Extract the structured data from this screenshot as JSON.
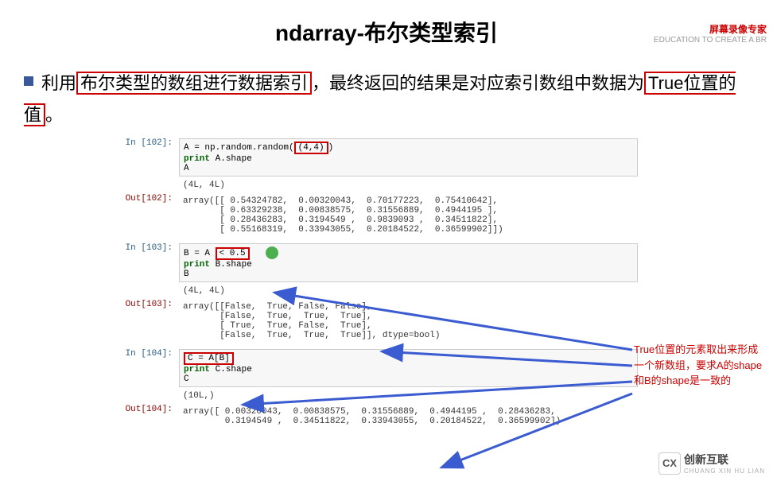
{
  "watermark": {
    "line1": "屏幕录像专家",
    "line2": "EDUCATION TO CREATE A BR"
  },
  "title": "ndarray-布尔类型索引",
  "desc": {
    "part1": "利用",
    "highlight1": "布尔类型的数组进行数据索引",
    "part2": "，最终返回的结果是对应索引数组中数据为",
    "highlight2": "True位置的值",
    "part3": "。"
  },
  "cells": [
    {
      "in_prompt": "In [102]:",
      "code": {
        "line1a": "A = np.random.random(",
        "line1b": "(4,4)",
        "line1c": ")",
        "line2a": "print",
        "line2b": " A.shape",
        "line3": "A"
      },
      "result": "(4L, 4L)",
      "out_prompt": "Out[102]:",
      "out": "array([[ 0.54324782,  0.00320043,  0.70177223,  0.75410642],\n       [ 0.63329238,  0.00838575,  0.31556889,  0.4944195 ],\n       [ 0.28436283,  0.3194549 ,  0.9839093 ,  0.34511822],\n       [ 0.55168319,  0.33943055,  0.20184522,  0.36599902]])"
    },
    {
      "in_prompt": "In [103]:",
      "code": {
        "line1a": "B = A ",
        "line1b": "< 0.5",
        "line2a": "print",
        "line2b": " B.shape",
        "line3": "B"
      },
      "result": "(4L, 4L)",
      "out_prompt": "Out[103]:",
      "out": "array([[False,  True, False, False],\n       [False,  True,  True,  True],\n       [ True,  True, False,  True],\n       [False,  True,  True,  True]], dtype=bool)"
    },
    {
      "in_prompt": "In [104]:",
      "code": {
        "line1": "C = A[B]",
        "line2a": "print",
        "line2b": " C.shape",
        "line3": "C"
      },
      "result": "(10L,)",
      "out_prompt": "Out[104]:",
      "out": "array([ 0.00320043,  0.00838575,  0.31556889,  0.4944195 ,  0.28436283,\n        0.3194549 ,  0.34511822,  0.33943055,  0.20184522,  0.36599902])"
    }
  ],
  "annotation": "True位置的元素取出来形成一个新数组，要求A的shape和B的shape是一致的",
  "logo": {
    "icon": "CX",
    "text": "创新互联",
    "sub": "CHUANG XIN HU LIAN"
  }
}
